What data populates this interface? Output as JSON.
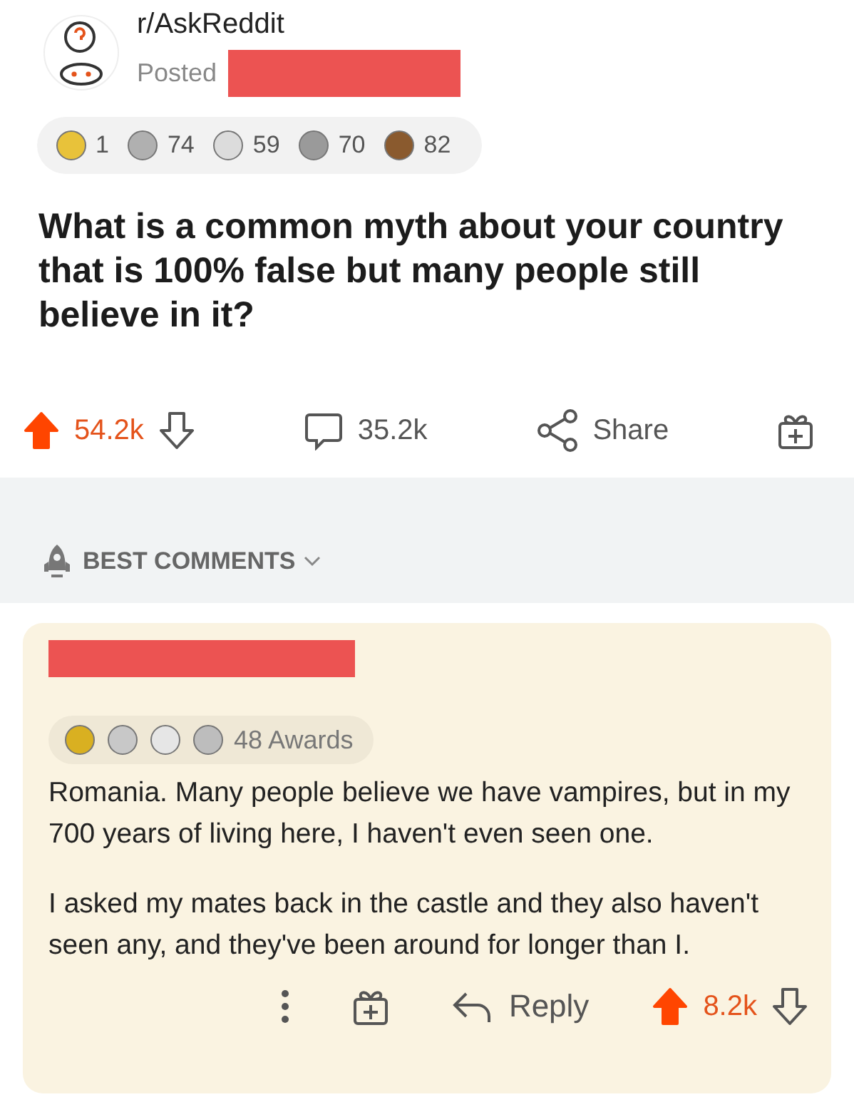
{
  "post": {
    "subreddit": "r/AskReddit",
    "posted_label": "Posted",
    "awards": [
      {
        "color": "#e8c23a",
        "count": "1"
      },
      {
        "color": "#b0b0b0",
        "count": "74"
      },
      {
        "color": "#dcdcdc",
        "count": "59"
      },
      {
        "color": "#9a9a9a",
        "count": "70"
      },
      {
        "color": "#8a5a2e",
        "count": "82"
      }
    ],
    "title": "What is a common myth about your country that is 100% false but many people still believe in it?",
    "score": "54.2k",
    "upvoted": true,
    "comments": "35.2k",
    "share": "Share"
  },
  "sort": {
    "label": "BEST COMMENTS"
  },
  "comment": {
    "awards": [
      {
        "color": "#d9b021"
      },
      {
        "color": "#c8c8c8"
      },
      {
        "color": "#e6e6e6"
      },
      {
        "color": "#bdbdbd"
      }
    ],
    "awards_label": "48 Awards",
    "paragraphs": [
      "Romania. Many people believe we have vampires, but in my 700 years of living here, I haven't even seen one.",
      "I asked my mates back in the castle and they also haven't seen any, and they've been around for longer than I."
    ],
    "reply": "Reply",
    "score": "8.2k",
    "upvoted": true
  }
}
